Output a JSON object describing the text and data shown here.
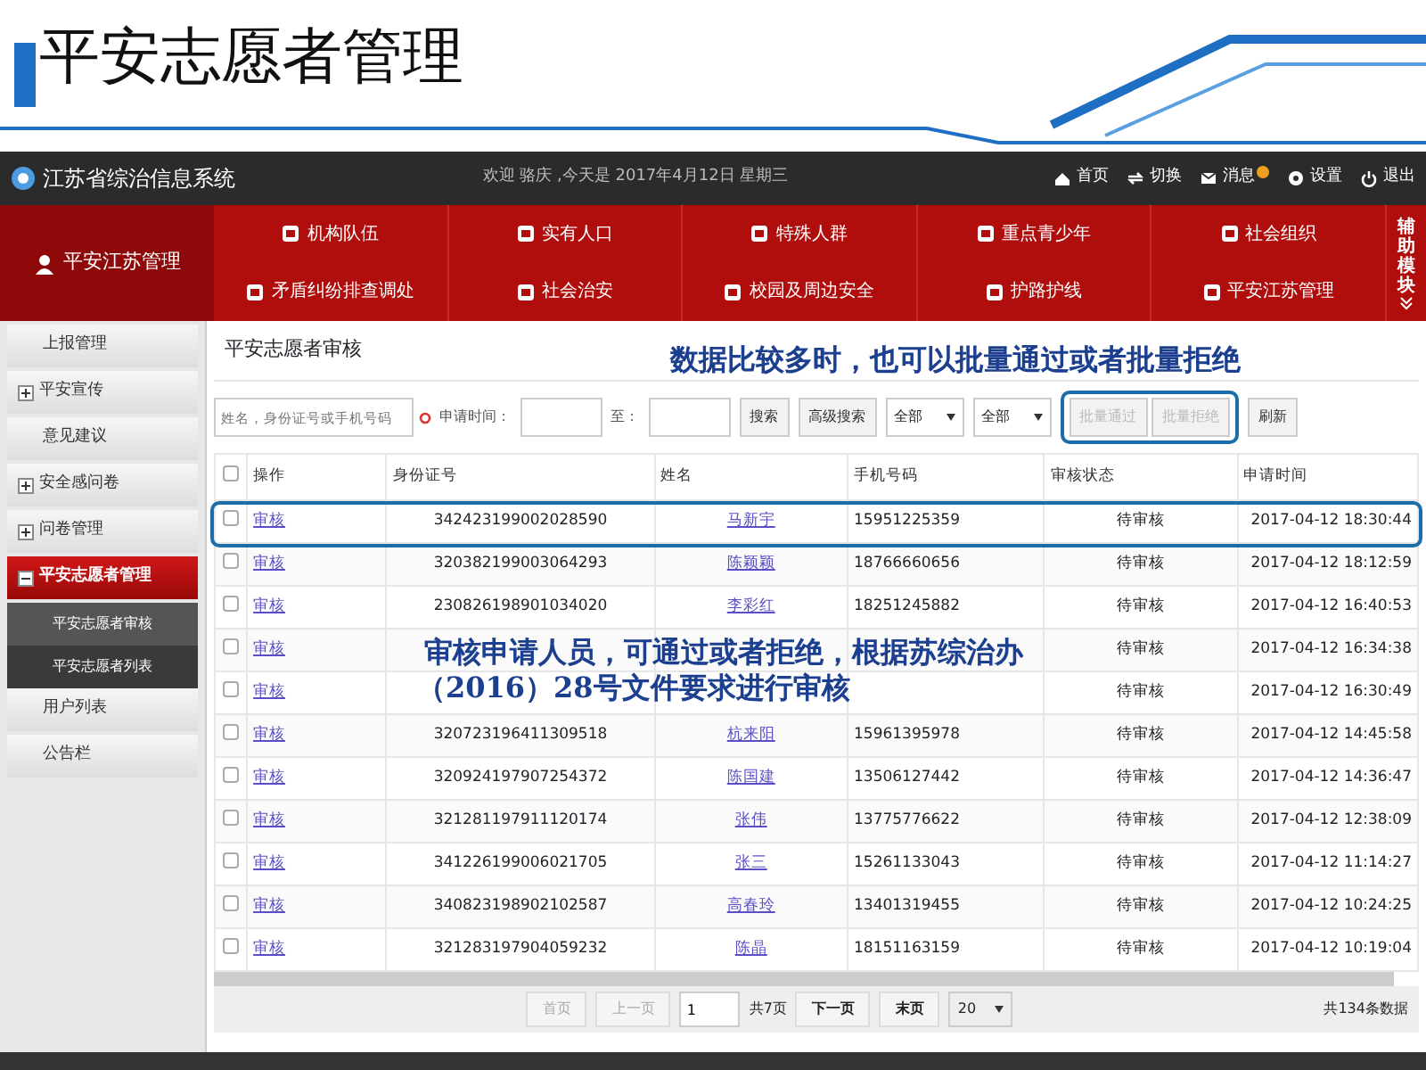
{
  "slide_title": "平安志愿者管理",
  "app": {
    "logo_title": "江苏省综治信息系统",
    "welcome": "欢迎 骆庆 ,今天是 2017年4月12日 星期三",
    "header_links": [
      {
        "label": "首页",
        "kind": "home"
      },
      {
        "label": "切换",
        "kind": "switch"
      },
      {
        "label": "消息",
        "kind": "mail"
      },
      {
        "label": "设置",
        "kind": "gear"
      },
      {
        "label": "退出",
        "kind": "power"
      }
    ],
    "nav_home": "平安江苏管理",
    "nav_items": [
      {
        "label": "机构队伍"
      },
      {
        "label": "实有人口"
      },
      {
        "label": "特殊人群"
      },
      {
        "label": "重点青少年"
      },
      {
        "label": "社会组织"
      },
      {
        "label": "矛盾纠纷排查调处"
      },
      {
        "label": "社会治安"
      },
      {
        "label": "校园及周边安全"
      },
      {
        "label": "护路护线"
      },
      {
        "label": "平安江苏管理"
      }
    ],
    "aux_label": "辅助模块"
  },
  "sidebar": {
    "items": [
      {
        "label": "上报管理",
        "kind": "plain",
        "selected": false
      },
      {
        "label": "平安宣传",
        "kind": "group",
        "expanded": false,
        "selected": false
      },
      {
        "label": "意见建议",
        "kind": "plain",
        "selected": false
      },
      {
        "label": "安全感问卷",
        "kind": "group",
        "expanded": false,
        "selected": false
      },
      {
        "label": "问卷管理",
        "kind": "group",
        "expanded": false,
        "selected": false
      },
      {
        "label": "平安志愿者管理",
        "kind": "group",
        "expanded": true,
        "selected": true,
        "children": [
          {
            "label": "平安志愿者审核",
            "selected": true
          },
          {
            "label": "平安志愿者列表",
            "selected": false
          }
        ]
      },
      {
        "label": "用户列表",
        "kind": "plain",
        "selected": false
      },
      {
        "label": "公告栏",
        "kind": "plain",
        "selected": false
      }
    ]
  },
  "panel": {
    "title": "平安志愿者审核",
    "search": {
      "placeholder": "姓名，身份证号或手机号码"
    },
    "date_label": "申请时间：",
    "date_to_label": "至：",
    "search_button": "搜索",
    "advanced_button": "高级搜索",
    "filters": [
      {
        "value": "全部"
      },
      {
        "value": "全部"
      }
    ],
    "batch_buttons": [
      {
        "label": "批量通过",
        "disabled": true
      },
      {
        "label": "批量拒绝",
        "disabled": true
      }
    ],
    "refresh_button": "刷新",
    "table": {
      "select_all_checked": false,
      "columns": [
        "操作",
        "身份证号",
        "姓名",
        "手机号码",
        "审核状态",
        "申请时间"
      ],
      "rows": [
        {
          "checked": false,
          "action": "审核",
          "id": "342423199002028590",
          "name": "马新宇",
          "phone": "15951225359",
          "status": "待审核",
          "time": "2017-04-12 18:30:44"
        },
        {
          "checked": false,
          "action": "审核",
          "id": "320382199003064293",
          "name": "陈颖颖",
          "phone": "18766660656",
          "status": "待审核",
          "time": "2017-04-12 18:12:59"
        },
        {
          "checked": false,
          "action": "审核",
          "id": "230826198901034020",
          "name": "李彩红",
          "phone": "18251245882",
          "status": "待审核",
          "time": "2017-04-12 16:40:53"
        },
        {
          "checked": false,
          "action": "审核",
          "status": "待审核",
          "time": "2017-04-12 16:34:38"
        },
        {
          "checked": false,
          "action": "审核",
          "status": "待审核",
          "time": "2017-04-12 16:30:49"
        },
        {
          "checked": false,
          "action": "审核",
          "id": "320723196411309518",
          "name": "杭来阳",
          "phone": "15961395978",
          "status": "待审核",
          "time": "2017-04-12 14:45:58"
        },
        {
          "checked": false,
          "action": "审核",
          "id": "320924197907254372",
          "name": "陈国建",
          "phone": "13506127442",
          "status": "待审核",
          "time": "2017-04-12 14:36:47"
        },
        {
          "checked": false,
          "action": "审核",
          "id": "321281197911120174",
          "name": "张伟",
          "phone": "13775776622",
          "status": "待审核",
          "time": "2017-04-12 12:38:09"
        },
        {
          "checked": false,
          "action": "审核",
          "id": "341226199006021705",
          "name": "张三",
          "phone": "15261133043",
          "status": "待审核",
          "time": "2017-04-12 11:14:27"
        },
        {
          "checked": false,
          "action": "审核",
          "id": "340823198902102587",
          "name": "高春玲",
          "phone": "13401319455",
          "status": "待审核",
          "time": "2017-04-12 10:24:25"
        },
        {
          "checked": false,
          "action": "审核",
          "id": "321283197904059232",
          "name": "陈晶",
          "phone": "18151163159",
          "status": "待审核",
          "time": "2017-04-12 10:19:04"
        }
      ]
    },
    "pagination": {
      "first": {
        "label": "首页",
        "disabled": true
      },
      "prev": {
        "label": "上一页",
        "disabled": true
      },
      "page": "1",
      "total_pages": "共7页",
      "next": {
        "label": "下一页",
        "disabled": false
      },
      "last": {
        "label": "末页",
        "disabled": false
      },
      "page_size": "20",
      "total": "共134条数据"
    }
  },
  "annotations": [
    {
      "kind": "batch",
      "lines": [
        "数据比较多时，也可以批量通过或者批量拒绝"
      ]
    },
    {
      "kind": "row",
      "lines": [
        "审核申请人员，可通过或者拒绝，根据苏综治办",
        "（2016）28号文件要求进行审核"
      ]
    }
  ]
}
